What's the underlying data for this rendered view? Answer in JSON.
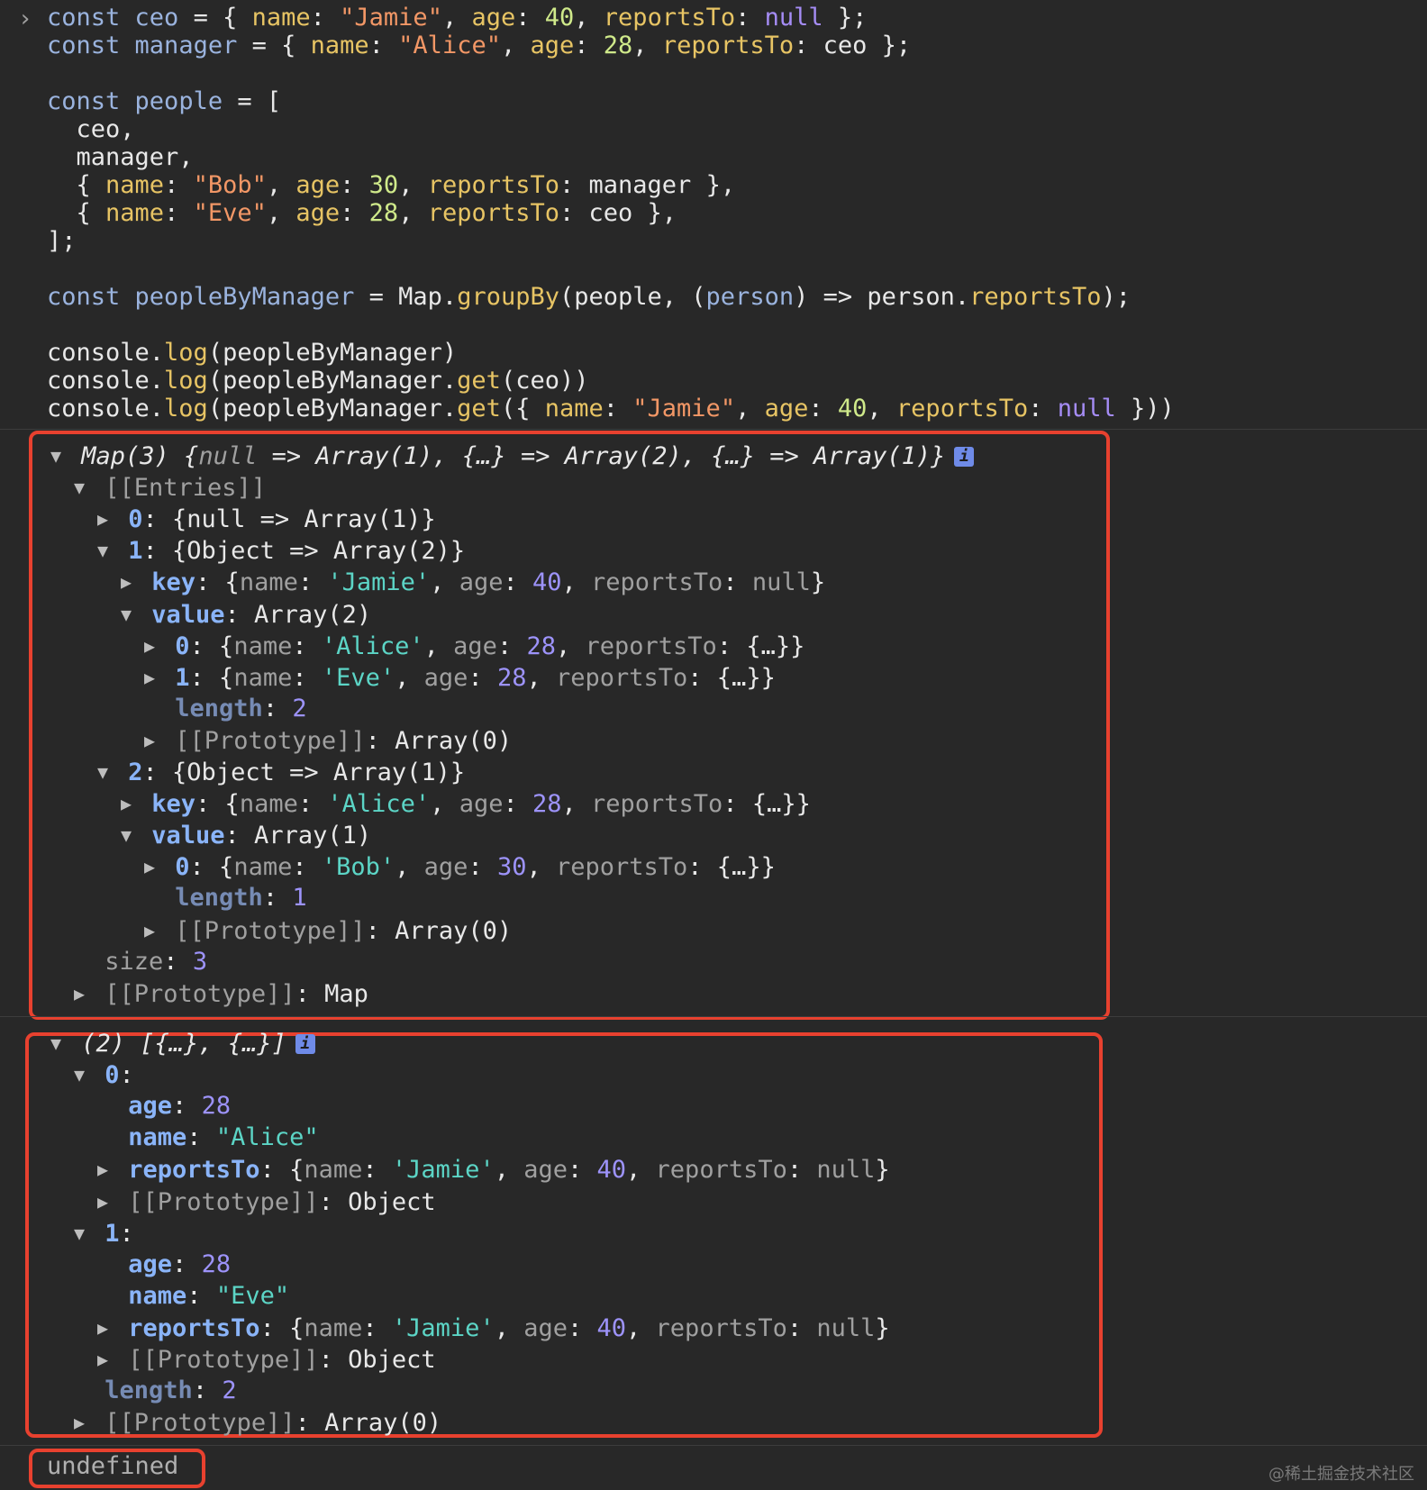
{
  "input": {
    "prompt": "›",
    "lines": [
      [
        [
          "kw",
          "const "
        ],
        [
          "var",
          "ceo"
        ],
        [
          "pl",
          " = { "
        ],
        [
          "prop",
          "name"
        ],
        [
          "pl",
          ": "
        ],
        [
          "str",
          "\"Jamie\""
        ],
        [
          "pl",
          ", "
        ],
        [
          "prop",
          "age"
        ],
        [
          "pl",
          ": "
        ],
        [
          "num",
          "40"
        ],
        [
          "pl",
          ", "
        ],
        [
          "prop",
          "reportsTo"
        ],
        [
          "pl",
          ": "
        ],
        [
          "nul",
          "null"
        ],
        [
          "pl",
          " };"
        ]
      ],
      [
        [
          "kw",
          "const "
        ],
        [
          "var",
          "manager"
        ],
        [
          "pl",
          " = { "
        ],
        [
          "prop",
          "name"
        ],
        [
          "pl",
          ": "
        ],
        [
          "str",
          "\"Alice\""
        ],
        [
          "pl",
          ", "
        ],
        [
          "prop",
          "age"
        ],
        [
          "pl",
          ": "
        ],
        [
          "num",
          "28"
        ],
        [
          "pl",
          ", "
        ],
        [
          "prop",
          "reportsTo"
        ],
        [
          "pl",
          ": ceo };"
        ]
      ],
      [],
      [
        [
          "kw",
          "const "
        ],
        [
          "var",
          "people"
        ],
        [
          "pl",
          " = ["
        ]
      ],
      [
        [
          "pl",
          "  ceo,"
        ]
      ],
      [
        [
          "pl",
          "  manager,"
        ]
      ],
      [
        [
          "pl",
          "  { "
        ],
        [
          "prop",
          "name"
        ],
        [
          "pl",
          ": "
        ],
        [
          "str",
          "\"Bob\""
        ],
        [
          "pl",
          ", "
        ],
        [
          "prop",
          "age"
        ],
        [
          "pl",
          ": "
        ],
        [
          "num",
          "30"
        ],
        [
          "pl",
          ", "
        ],
        [
          "prop",
          "reportsTo"
        ],
        [
          "pl",
          ": manager },"
        ]
      ],
      [
        [
          "pl",
          "  { "
        ],
        [
          "prop",
          "name"
        ],
        [
          "pl",
          ": "
        ],
        [
          "str",
          "\"Eve\""
        ],
        [
          "pl",
          ", "
        ],
        [
          "prop",
          "age"
        ],
        [
          "pl",
          ": "
        ],
        [
          "num",
          "28"
        ],
        [
          "pl",
          ", "
        ],
        [
          "prop",
          "reportsTo"
        ],
        [
          "pl",
          ": ceo },"
        ]
      ],
      [
        [
          "pl",
          "];"
        ]
      ],
      [],
      [
        [
          "kw",
          "const "
        ],
        [
          "var",
          "peopleByManager"
        ],
        [
          "pl",
          " = Map."
        ],
        [
          "fn",
          "groupBy"
        ],
        [
          "pl",
          "(people, ("
        ],
        [
          "var",
          "person"
        ],
        [
          "pl",
          ") => person."
        ],
        [
          "prop",
          "reportsTo"
        ],
        [
          "pl",
          ");"
        ]
      ],
      [],
      [
        [
          "pl",
          "console."
        ],
        [
          "fn",
          "log"
        ],
        [
          "pl",
          "(peopleByManager)"
        ]
      ],
      [
        [
          "pl",
          "console."
        ],
        [
          "fn",
          "log"
        ],
        [
          "pl",
          "(peopleByManager."
        ],
        [
          "fn",
          "get"
        ],
        [
          "pl",
          "(ceo))"
        ]
      ],
      [
        [
          "pl",
          "console."
        ],
        [
          "fn",
          "log"
        ],
        [
          "pl",
          "(peopleByManager."
        ],
        [
          "fn",
          "get"
        ],
        [
          "pl",
          "({ "
        ],
        [
          "prop",
          "name"
        ],
        [
          "pl",
          ": "
        ],
        [
          "str",
          "\"Jamie\""
        ],
        [
          "pl",
          ", "
        ],
        [
          "prop",
          "age"
        ],
        [
          "pl",
          ": "
        ],
        [
          "num",
          "40"
        ],
        [
          "pl",
          ", "
        ],
        [
          "prop",
          "reportsTo"
        ],
        [
          "pl",
          ": "
        ],
        [
          "nul",
          "null"
        ],
        [
          "pl",
          " }))"
        ]
      ]
    ]
  },
  "output1": {
    "lines": [
      {
        "i": 0,
        "t": "down",
        "s": [
          [
            "o-plain it",
            "Map(3) {"
          ],
          [
            "o-null it",
            "null"
          ],
          [
            "o-plain it",
            " => Array(1), {…} => Array(2), {…} => Array(1)}"
          ]
        ],
        "info": true
      },
      {
        "i": 1,
        "t": "down",
        "s": [
          [
            "o-dim",
            "[[Entries]]"
          ]
        ]
      },
      {
        "i": 2,
        "t": "right",
        "s": [
          [
            "o-key",
            "0"
          ],
          [
            "o-plain",
            ": {null => Array(1)}"
          ]
        ]
      },
      {
        "i": 2,
        "t": "down",
        "s": [
          [
            "o-key",
            "1"
          ],
          [
            "o-plain",
            ": {Object => Array(2)}"
          ]
        ]
      },
      {
        "i": 3,
        "t": "right",
        "s": [
          [
            "o-key",
            "key"
          ],
          [
            "o-plain",
            ": {"
          ],
          [
            "o-dim",
            "name"
          ],
          [
            "o-plain",
            ": "
          ],
          [
            "o-str",
            "'Jamie'"
          ],
          [
            "o-plain",
            ", "
          ],
          [
            "o-dim",
            "age"
          ],
          [
            "o-plain",
            ": "
          ],
          [
            "o-num",
            "40"
          ],
          [
            "o-plain",
            ", "
          ],
          [
            "o-dim",
            "reportsTo"
          ],
          [
            "o-plain",
            ": "
          ],
          [
            "o-null",
            "null"
          ],
          [
            "o-plain",
            "}"
          ]
        ]
      },
      {
        "i": 3,
        "t": "down",
        "s": [
          [
            "o-key",
            "value"
          ],
          [
            "o-plain",
            ": Array(2)"
          ]
        ]
      },
      {
        "i": 4,
        "t": "right",
        "s": [
          [
            "o-key",
            "0"
          ],
          [
            "o-plain",
            ": {"
          ],
          [
            "o-dim",
            "name"
          ],
          [
            "o-plain",
            ": "
          ],
          [
            "o-str",
            "'Alice'"
          ],
          [
            "o-plain",
            ", "
          ],
          [
            "o-dim",
            "age"
          ],
          [
            "o-plain",
            ": "
          ],
          [
            "o-num",
            "28"
          ],
          [
            "o-plain",
            ", "
          ],
          [
            "o-dim",
            "reportsTo"
          ],
          [
            "o-plain",
            ": {…}}"
          ]
        ]
      },
      {
        "i": 4,
        "t": "right",
        "s": [
          [
            "o-key",
            "1"
          ],
          [
            "o-plain",
            ": {"
          ],
          [
            "o-dim",
            "name"
          ],
          [
            "o-plain",
            ": "
          ],
          [
            "o-str",
            "'Eve'"
          ],
          [
            "o-plain",
            ", "
          ],
          [
            "o-dim",
            "age"
          ],
          [
            "o-plain",
            ": "
          ],
          [
            "o-num",
            "28"
          ],
          [
            "o-plain",
            ", "
          ],
          [
            "o-dim",
            "reportsTo"
          ],
          [
            "o-plain",
            ": {…}}"
          ]
        ]
      },
      {
        "i": 4,
        "t": "none",
        "s": [
          [
            "o-keydim",
            "length"
          ],
          [
            "o-plain",
            ": "
          ],
          [
            "o-num",
            "2"
          ]
        ]
      },
      {
        "i": 4,
        "t": "right",
        "s": [
          [
            "o-dim",
            "[[Prototype]]"
          ],
          [
            "o-plain",
            ": Array(0)"
          ]
        ]
      },
      {
        "i": 2,
        "t": "down",
        "s": [
          [
            "o-key",
            "2"
          ],
          [
            "o-plain",
            ": {Object => Array(1)}"
          ]
        ]
      },
      {
        "i": 3,
        "t": "right",
        "s": [
          [
            "o-key",
            "key"
          ],
          [
            "o-plain",
            ": {"
          ],
          [
            "o-dim",
            "name"
          ],
          [
            "o-plain",
            ": "
          ],
          [
            "o-str",
            "'Alice'"
          ],
          [
            "o-plain",
            ", "
          ],
          [
            "o-dim",
            "age"
          ],
          [
            "o-plain",
            ": "
          ],
          [
            "o-num",
            "28"
          ],
          [
            "o-plain",
            ", "
          ],
          [
            "o-dim",
            "reportsTo"
          ],
          [
            "o-plain",
            ": {…}}"
          ]
        ]
      },
      {
        "i": 3,
        "t": "down",
        "s": [
          [
            "o-key",
            "value"
          ],
          [
            "o-plain",
            ": Array(1)"
          ]
        ]
      },
      {
        "i": 4,
        "t": "right",
        "s": [
          [
            "o-key",
            "0"
          ],
          [
            "o-plain",
            ": {"
          ],
          [
            "o-dim",
            "name"
          ],
          [
            "o-plain",
            ": "
          ],
          [
            "o-str",
            "'Bob'"
          ],
          [
            "o-plain",
            ", "
          ],
          [
            "o-dim",
            "age"
          ],
          [
            "o-plain",
            ": "
          ],
          [
            "o-num",
            "30"
          ],
          [
            "o-plain",
            ", "
          ],
          [
            "o-dim",
            "reportsTo"
          ],
          [
            "o-plain",
            ": {…}}"
          ]
        ]
      },
      {
        "i": 4,
        "t": "none",
        "s": [
          [
            "o-keydim",
            "length"
          ],
          [
            "o-plain",
            ": "
          ],
          [
            "o-num",
            "1"
          ]
        ]
      },
      {
        "i": 4,
        "t": "right",
        "s": [
          [
            "o-dim",
            "[[Prototype]]"
          ],
          [
            "o-plain",
            ": Array(0)"
          ]
        ]
      },
      {
        "i": 1,
        "t": "none",
        "s": [
          [
            "o-dim",
            "size"
          ],
          [
            "o-plain",
            ": "
          ],
          [
            "o-num",
            "3"
          ]
        ]
      },
      {
        "i": 1,
        "t": "right",
        "s": [
          [
            "o-dim",
            "[[Prototype]]"
          ],
          [
            "o-plain",
            ": Map"
          ]
        ]
      }
    ]
  },
  "output2": {
    "lines": [
      {
        "i": 0,
        "t": "down",
        "s": [
          [
            "o-plain it",
            "(2) [{…}, {…}]"
          ]
        ],
        "info": true
      },
      {
        "i": 1,
        "t": "down",
        "s": [
          [
            "o-key",
            "0"
          ],
          [
            "o-plain",
            ":"
          ]
        ]
      },
      {
        "i": 2,
        "t": "none",
        "s": [
          [
            "o-key",
            "age"
          ],
          [
            "o-plain",
            ": "
          ],
          [
            "o-num",
            "28"
          ]
        ]
      },
      {
        "i": 2,
        "t": "none",
        "s": [
          [
            "o-key",
            "name"
          ],
          [
            "o-plain",
            ": "
          ],
          [
            "o-str",
            "\"Alice\""
          ]
        ]
      },
      {
        "i": 2,
        "t": "right",
        "s": [
          [
            "o-key",
            "reportsTo"
          ],
          [
            "o-plain",
            ": {"
          ],
          [
            "o-dim",
            "name"
          ],
          [
            "o-plain",
            ": "
          ],
          [
            "o-str",
            "'Jamie'"
          ],
          [
            "o-plain",
            ", "
          ],
          [
            "o-dim",
            "age"
          ],
          [
            "o-plain",
            ": "
          ],
          [
            "o-num",
            "40"
          ],
          [
            "o-plain",
            ", "
          ],
          [
            "o-dim",
            "reportsTo"
          ],
          [
            "o-plain",
            ": "
          ],
          [
            "o-null",
            "null"
          ],
          [
            "o-plain",
            "}"
          ]
        ]
      },
      {
        "i": 2,
        "t": "right",
        "s": [
          [
            "o-dim",
            "[[Prototype]]"
          ],
          [
            "o-plain",
            ": Object"
          ]
        ]
      },
      {
        "i": 1,
        "t": "down",
        "s": [
          [
            "o-key",
            "1"
          ],
          [
            "o-plain",
            ":"
          ]
        ]
      },
      {
        "i": 2,
        "t": "none",
        "s": [
          [
            "o-key",
            "age"
          ],
          [
            "o-plain",
            ": "
          ],
          [
            "o-num",
            "28"
          ]
        ]
      },
      {
        "i": 2,
        "t": "none",
        "s": [
          [
            "o-key",
            "name"
          ],
          [
            "o-plain",
            ": "
          ],
          [
            "o-str",
            "\"Eve\""
          ]
        ]
      },
      {
        "i": 2,
        "t": "right",
        "s": [
          [
            "o-key",
            "reportsTo"
          ],
          [
            "o-plain",
            ": {"
          ],
          [
            "o-dim",
            "name"
          ],
          [
            "o-plain",
            ": "
          ],
          [
            "o-str",
            "'Jamie'"
          ],
          [
            "o-plain",
            ", "
          ],
          [
            "o-dim",
            "age"
          ],
          [
            "o-plain",
            ": "
          ],
          [
            "o-num",
            "40"
          ],
          [
            "o-plain",
            ", "
          ],
          [
            "o-dim",
            "reportsTo"
          ],
          [
            "o-plain",
            ": "
          ],
          [
            "o-null",
            "null"
          ],
          [
            "o-plain",
            "}"
          ]
        ]
      },
      {
        "i": 2,
        "t": "right",
        "s": [
          [
            "o-dim",
            "[[Prototype]]"
          ],
          [
            "o-plain",
            ": Object"
          ]
        ]
      },
      {
        "i": 1,
        "t": "none",
        "s": [
          [
            "o-keydim",
            "length"
          ],
          [
            "o-plain",
            ": "
          ],
          [
            "o-num",
            "2"
          ]
        ]
      },
      {
        "i": 1,
        "t": "right",
        "s": [
          [
            "o-dim",
            "[[Prototype]]"
          ],
          [
            "o-plain",
            ": Array(0)"
          ]
        ]
      }
    ]
  },
  "output3": {
    "text": "undefined"
  },
  "info_glyph": "i",
  "watermark": "@稀土掘金技术社区",
  "colors": {
    "highlight_box": "#e8412f",
    "background": "#282828"
  }
}
